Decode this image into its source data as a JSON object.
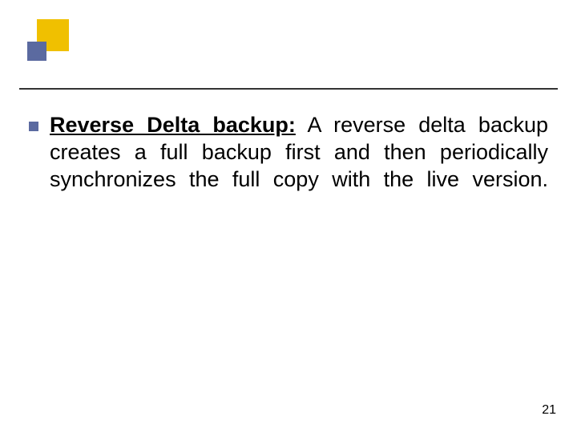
{
  "slide": {
    "bullet": {
      "term": "Reverse Delta backup:",
      "definition": " A reverse delta backup creates a full backup first and then periodically synchronizes the full copy with the live version."
    },
    "page_number": "21"
  }
}
